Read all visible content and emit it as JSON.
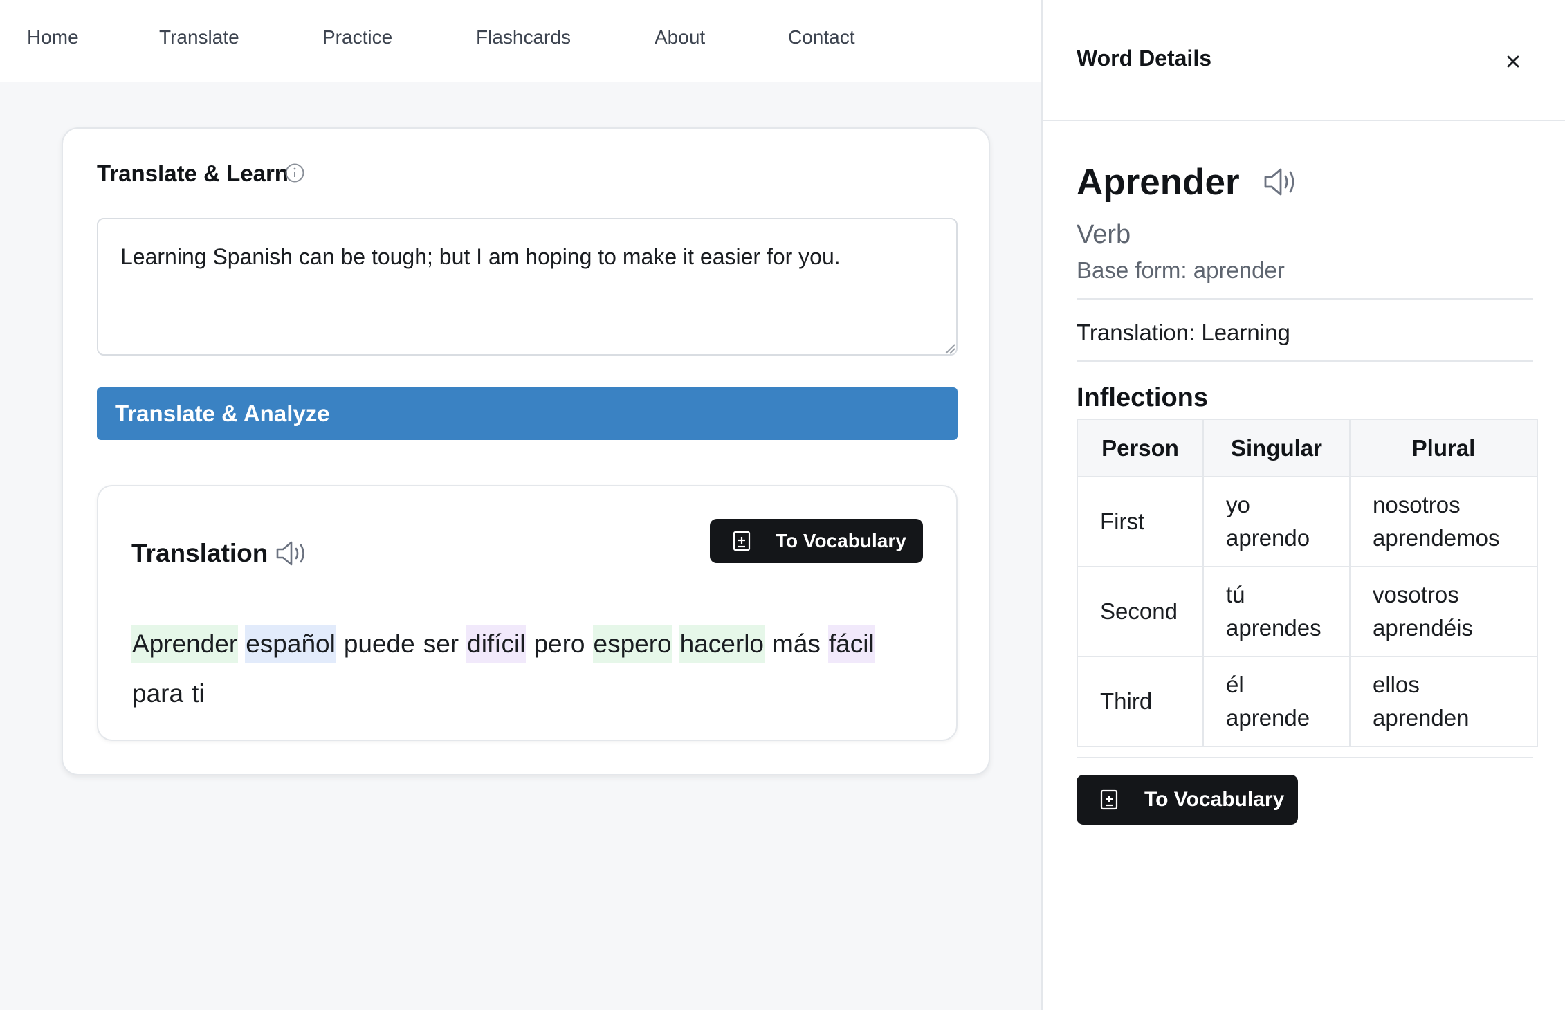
{
  "nav": {
    "items": [
      {
        "label": "Home"
      },
      {
        "label": "Translate"
      },
      {
        "label": "Practice"
      },
      {
        "label": "Flashcards"
      },
      {
        "label": "About"
      },
      {
        "label": "Contact"
      }
    ]
  },
  "card": {
    "title": "Translate & Learn",
    "info_icon": "info-icon",
    "input_value": "Learning Spanish can be tough; but I am hoping to make it easier for you.",
    "submit_label": "Translate & Analyze",
    "accent_color": "#3a82c3"
  },
  "result": {
    "title": "Translation",
    "speaker_icon": "speaker-icon",
    "vocab_button_label": "To Vocabulary",
    "vocab_icon": "bookmark-plus-icon",
    "words": [
      {
        "text": "Aprender",
        "highlight": "#e6f7e9"
      },
      {
        "text": "español",
        "highlight": "#e2ebfb"
      },
      {
        "text": "puede",
        "highlight": ""
      },
      {
        "text": "ser",
        "highlight": ""
      },
      {
        "text": "difícil",
        "highlight": "#f1e9fb"
      },
      {
        "text": "pero",
        "highlight": ""
      },
      {
        "text": "espero",
        "highlight": "#e6f7e9"
      },
      {
        "text": "hacerlo",
        "highlight": "#e6f7e9"
      },
      {
        "text": "más",
        "highlight": ""
      },
      {
        "text": "fácil",
        "highlight": "#f1e9fb"
      },
      {
        "text": "para",
        "highlight": ""
      },
      {
        "text": "ti",
        "highlight": ""
      }
    ]
  },
  "panel": {
    "title": "Word Details",
    "close_icon": "close-icon",
    "word": "Aprender",
    "speaker_icon": "speaker-icon",
    "part_of_speech": "Verb",
    "base_form": "Base form: aprender",
    "translation": "Translation: Learning",
    "inflections_title": "Inflections",
    "table": {
      "headers": [
        "Person",
        "Singular",
        "Plural"
      ],
      "rows": [
        [
          "First",
          "yo aprendo",
          "nosotros aprendemos"
        ],
        [
          "Second",
          "tú aprendes",
          "vosotros aprendéis"
        ],
        [
          "Third",
          "él aprende",
          "ellos aprenden"
        ]
      ]
    },
    "vocab_button_label": "To Vocabulary",
    "vocab_icon": "bookmark-plus-icon"
  }
}
